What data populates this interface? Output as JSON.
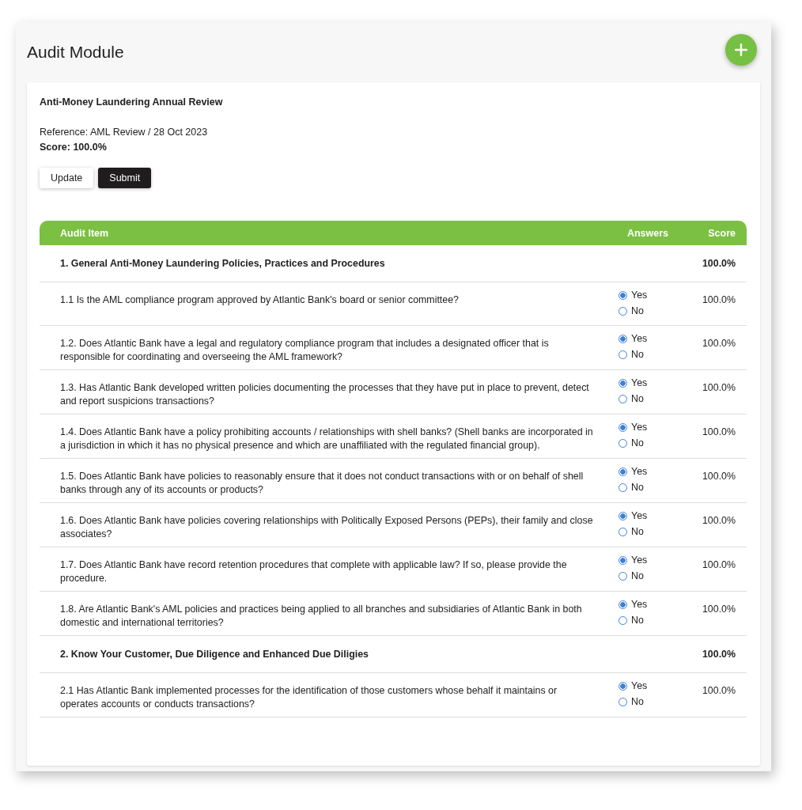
{
  "page": {
    "title": "Audit Module"
  },
  "audit": {
    "name": "Anti-Money Laundering Annual Review",
    "reference": "Reference: AML Review / 28 Oct 2023",
    "score": "Score: 100.0%"
  },
  "buttons": [
    {
      "label": "Update",
      "kind": "secondary"
    },
    {
      "label": "Submit",
      "kind": "primary"
    }
  ],
  "table": {
    "columns": [
      "Audit Item",
      "Answers",
      "Score"
    ],
    "rows": [
      {
        "kind": "section",
        "text": "1. General Anti-Money Laundering Policies, Practices and Procedures",
        "score": "100.0%"
      },
      {
        "kind": "question",
        "text": "1.1 Is the AML compliance program approved by Atlantic Bank's board or senior committee?",
        "options": [
          {
            "label": "Yes",
            "selected": true
          },
          {
            "label": "No",
            "selected": false
          }
        ],
        "score": "100.0%"
      },
      {
        "kind": "question",
        "text": "1.2. Does Atlantic Bank have a legal and regulatory compliance program that includes a designated officer that is responsible for coordinating and overseeing the AML framework?",
        "options": [
          {
            "label": "Yes",
            "selected": true
          },
          {
            "label": "No",
            "selected": false
          }
        ],
        "score": "100.0%"
      },
      {
        "kind": "question",
        "text": "1.3. Has Atlantic Bank developed written policies documenting the processes that they have put in place to prevent, detect and report suspicions transactions?",
        "options": [
          {
            "label": "Yes",
            "selected": true
          },
          {
            "label": "No",
            "selected": false
          }
        ],
        "score": "100.0%"
      },
      {
        "kind": "question",
        "text": "1.4. Does Atlantic Bank have a policy prohibiting accounts / relationships with shell banks? (Shell banks are incorporated in a jurisdiction in which it has no physical presence and which are unaffiliated with the regulated financial group).",
        "options": [
          {
            "label": "Yes",
            "selected": true
          },
          {
            "label": "No",
            "selected": false
          }
        ],
        "score": "100.0%"
      },
      {
        "kind": "question",
        "text": "1.5. Does Atlantic Bank have policies to reasonably ensure that it does not conduct transactions with or on behalf of shell banks through any of its accounts or products?",
        "options": [
          {
            "label": "Yes",
            "selected": true
          },
          {
            "label": "No",
            "selected": false
          }
        ],
        "score": "100.0%"
      },
      {
        "kind": "question",
        "text": "1.6. Does Atlantic Bank have policies covering relationships with Politically Exposed Persons (PEPs), their family and close associates?",
        "options": [
          {
            "label": "Yes",
            "selected": true
          },
          {
            "label": "No",
            "selected": false
          }
        ],
        "score": "100.0%"
      },
      {
        "kind": "question",
        "text": "1.7. Does Atlantic Bank have record retention procedures that complete with applicable law? If so, please provide the procedure.",
        "options": [
          {
            "label": "Yes",
            "selected": true
          },
          {
            "label": "No",
            "selected": false
          }
        ],
        "score": "100.0%"
      },
      {
        "kind": "question",
        "text": "1.8. Are Atlantic Bank's AML policies and practices being applied to all branches and subsidiaries of Atlantic Bank in both domestic and international territories?",
        "options": [
          {
            "label": "Yes",
            "selected": true
          },
          {
            "label": "No",
            "selected": false
          }
        ],
        "score": "100.0%"
      },
      {
        "kind": "section",
        "text": "2. Know Your Customer, Due Diligence and Enhanced Due Diligies",
        "score": "100.0%"
      },
      {
        "kind": "question",
        "text": "2.1 Has Atlantic Bank implemented processes for the identification of those customers whose behalf it maintains or operates accounts or conducts transactions?",
        "options": [
          {
            "label": "Yes",
            "selected": true
          },
          {
            "label": "No",
            "selected": false
          }
        ],
        "score": "100.0%"
      }
    ]
  }
}
